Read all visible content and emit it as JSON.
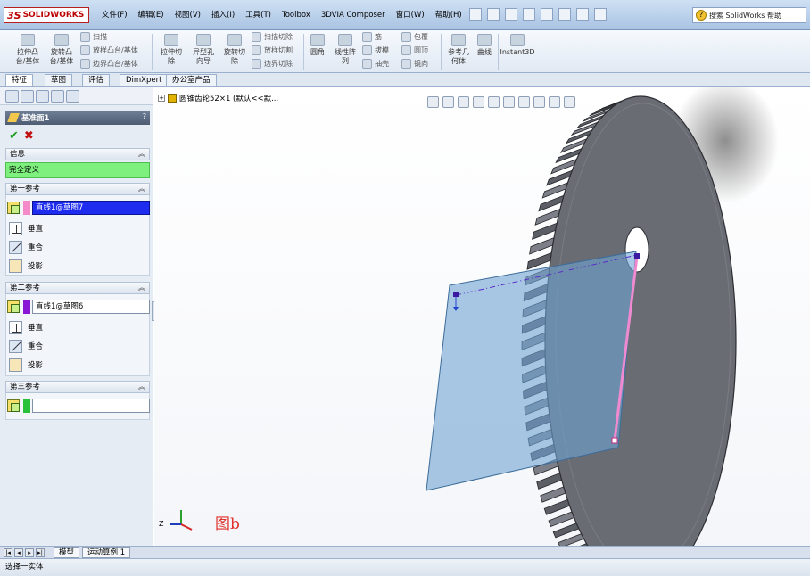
{
  "app": {
    "logo_ds": "3S",
    "logo_text": "SOLIDWORKS"
  },
  "menu": [
    "文件(F)",
    "编辑(E)",
    "视图(V)",
    "插入(I)",
    "工具(T)",
    "Toolbox",
    "3DVIA Composer",
    "窗口(W)",
    "帮助(H)"
  ],
  "search": {
    "label": "搜索 SolidWorks 帮助"
  },
  "ribbon": {
    "extrude_boss": "拉伸凸\n台/基体",
    "revolve_boss": "旋转凸\n台/基体",
    "sweep": "扫描",
    "loft_boss": "放样凸台/基体",
    "boundary_boss": "边界凸台/基体",
    "extrude_cut": "拉伸切\n除",
    "hole_wizard": "异型孔\n向导",
    "revolve_cut": "旋转切\n除",
    "sweep_cut": "扫描切除",
    "loft_cut": "放样切割",
    "boundary_cut": "边界切除",
    "fillet": "圆角",
    "linear_pattern": "线性阵\n列",
    "rib": "筋",
    "draft": "拔模",
    "shell": "抽壳",
    "wrap": "包覆",
    "dome": "圆顶",
    "mirror": "镜向",
    "ref_geometry": "参考几\n何体",
    "curves": "曲线",
    "instant3d": "Instant3D"
  },
  "tabs": [
    "特征",
    "草图",
    "评估",
    "DimXpert",
    "办公室产品"
  ],
  "property_manager": {
    "title": "基准面1",
    "help": "?",
    "info_header": "信息",
    "info_status": "完全定义",
    "first_ref": {
      "header": "第一参考",
      "value": "直线1@草图7",
      "swatch": "#f58ac8",
      "options": [
        "垂直",
        "重合",
        "投影"
      ]
    },
    "second_ref": {
      "header": "第二参考",
      "value": "直线1@草图6",
      "swatch": "#8a16d6",
      "options": [
        "垂直",
        "重合",
        "投影"
      ]
    },
    "third_ref": {
      "header": "第三参考",
      "value": "",
      "swatch": "#27c13a"
    }
  },
  "tree": {
    "root_label": "圆锥齿轮52×1 (默认<<默..."
  },
  "viewport": {
    "figure_label": "图b",
    "triad_axis": "Z"
  },
  "bottom_tabs": [
    "模型",
    "运动算例 1"
  ],
  "status": "选择一实体",
  "colors": {
    "plane_fill": "#6fa3d3",
    "gear_body": "#6a6c74",
    "pink_line": "#f08ad0",
    "selected_field": "#1e2cf0",
    "status_green": "#7ef07e"
  }
}
